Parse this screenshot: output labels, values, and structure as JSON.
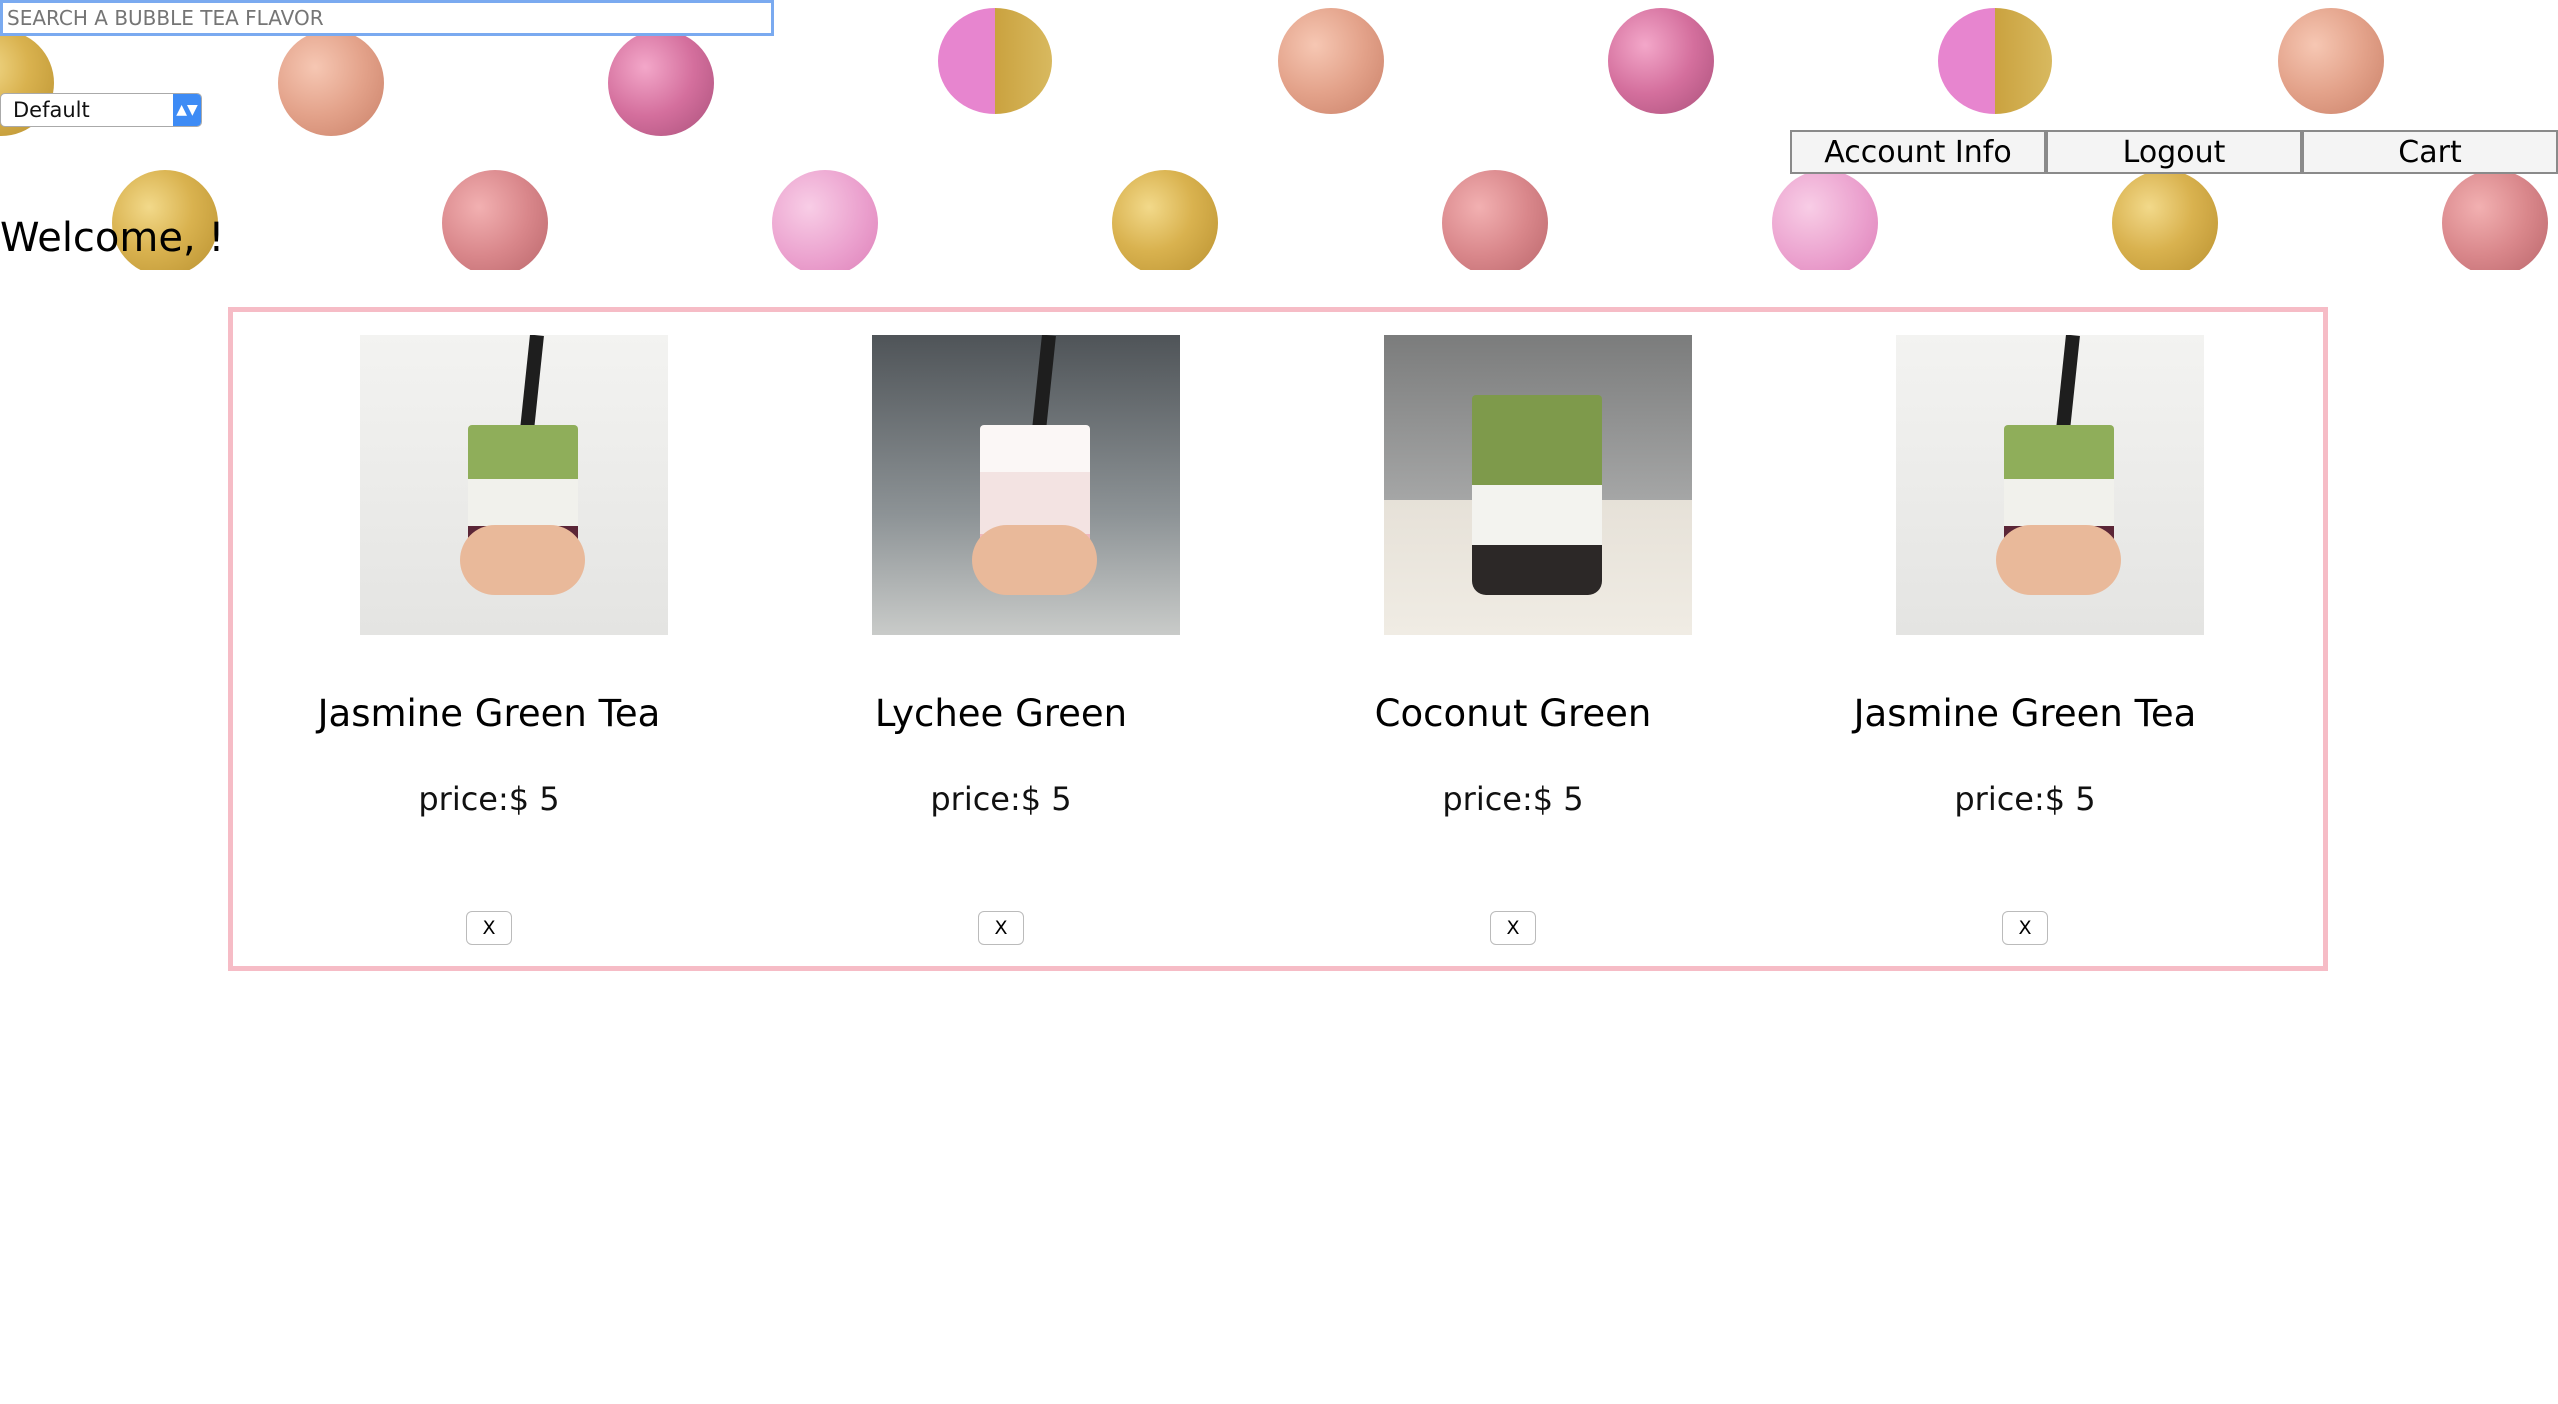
{
  "search": {
    "placeholder": "SEARCH A BUBBLE TEA FLAVOR",
    "value": ""
  },
  "sort": {
    "selected": "Default"
  },
  "nav": {
    "account_label": "Account Info",
    "logout_label": "Logout",
    "cart_label": "Cart"
  },
  "welcome": "Welcome, !",
  "products": [
    {
      "name": "Jasmine Green Tea",
      "price": "price:$ 5",
      "remove_label": "X",
      "image": "jasmine-green-tea-photo"
    },
    {
      "name": "Lychee Green",
      "price": "price:$ 5",
      "remove_label": "X",
      "image": "lychee-green-photo"
    },
    {
      "name": "Coconut Green",
      "price": "price:$ 5",
      "remove_label": "X",
      "image": "coconut-green-photo"
    },
    {
      "name": "Jasmine Green Tea",
      "price": "price:$ 5",
      "remove_label": "X",
      "image": "jasmine-green-tea-photo"
    }
  ],
  "colors": {
    "panel_border": "#f6bcc6",
    "search_focus": "#7aaaf0",
    "select_accent": "#3d8bf5"
  }
}
